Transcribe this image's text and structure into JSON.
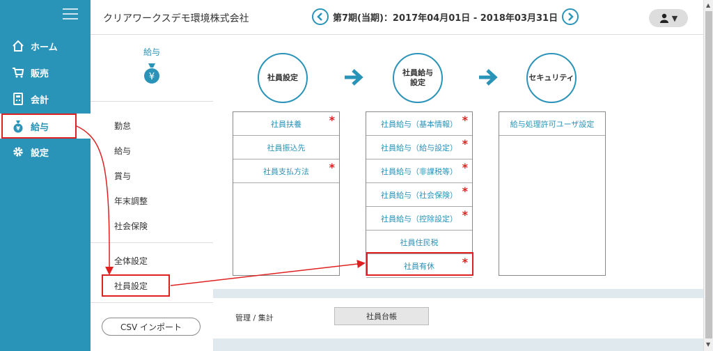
{
  "header": {
    "company": "クリアワークスデモ環境株式会社",
    "period": "第7期(当期)：2017年04月01日 - 2018年03月31日"
  },
  "nav": {
    "items": [
      {
        "label": "ホーム",
        "icon": "home-icon"
      },
      {
        "label": "販売",
        "icon": "cart-icon"
      },
      {
        "label": "会計",
        "icon": "calculator-icon"
      },
      {
        "label": "給与",
        "icon": "money-bag-icon"
      },
      {
        "label": "設定",
        "icon": "gear-icon"
      }
    ],
    "active_index": 3
  },
  "submenu": {
    "title": "給与",
    "items": [
      "勤怠",
      "給与",
      "賞与",
      "年末調整",
      "社会保険",
      "全体設定",
      "社員設定"
    ],
    "csv_button": "CSV インポート"
  },
  "flow": {
    "steps": [
      {
        "label": "社員設定"
      },
      {
        "label": "社員給与\n設定"
      },
      {
        "label": "セキュリティ"
      }
    ]
  },
  "columns": [
    {
      "cells": [
        {
          "label": "社員扶養",
          "required": true
        },
        {
          "label": "社員振込先",
          "required": false
        },
        {
          "label": "社員支払方法",
          "required": true
        }
      ]
    },
    {
      "cells": [
        {
          "label": "社員給与（基本情報）",
          "required": true
        },
        {
          "label": "社員給与（給与設定）",
          "required": true
        },
        {
          "label": "社員給与（非課税等）",
          "required": true
        },
        {
          "label": "社員給与（社会保険）",
          "required": true
        },
        {
          "label": "社員給与（控除設定）",
          "required": true
        },
        {
          "label": "社員住民税",
          "required": false
        },
        {
          "label": "社員有休",
          "required": true
        }
      ]
    },
    {
      "cells": [
        {
          "label": "給与処理許可ユーザ設定",
          "required": false
        }
      ]
    }
  ],
  "required_mark": "*",
  "bottom": {
    "label": "管理 / 集計",
    "button": "社員台帳"
  },
  "colors": {
    "accent": "#2a93b8",
    "highlight": "#e02020"
  }
}
